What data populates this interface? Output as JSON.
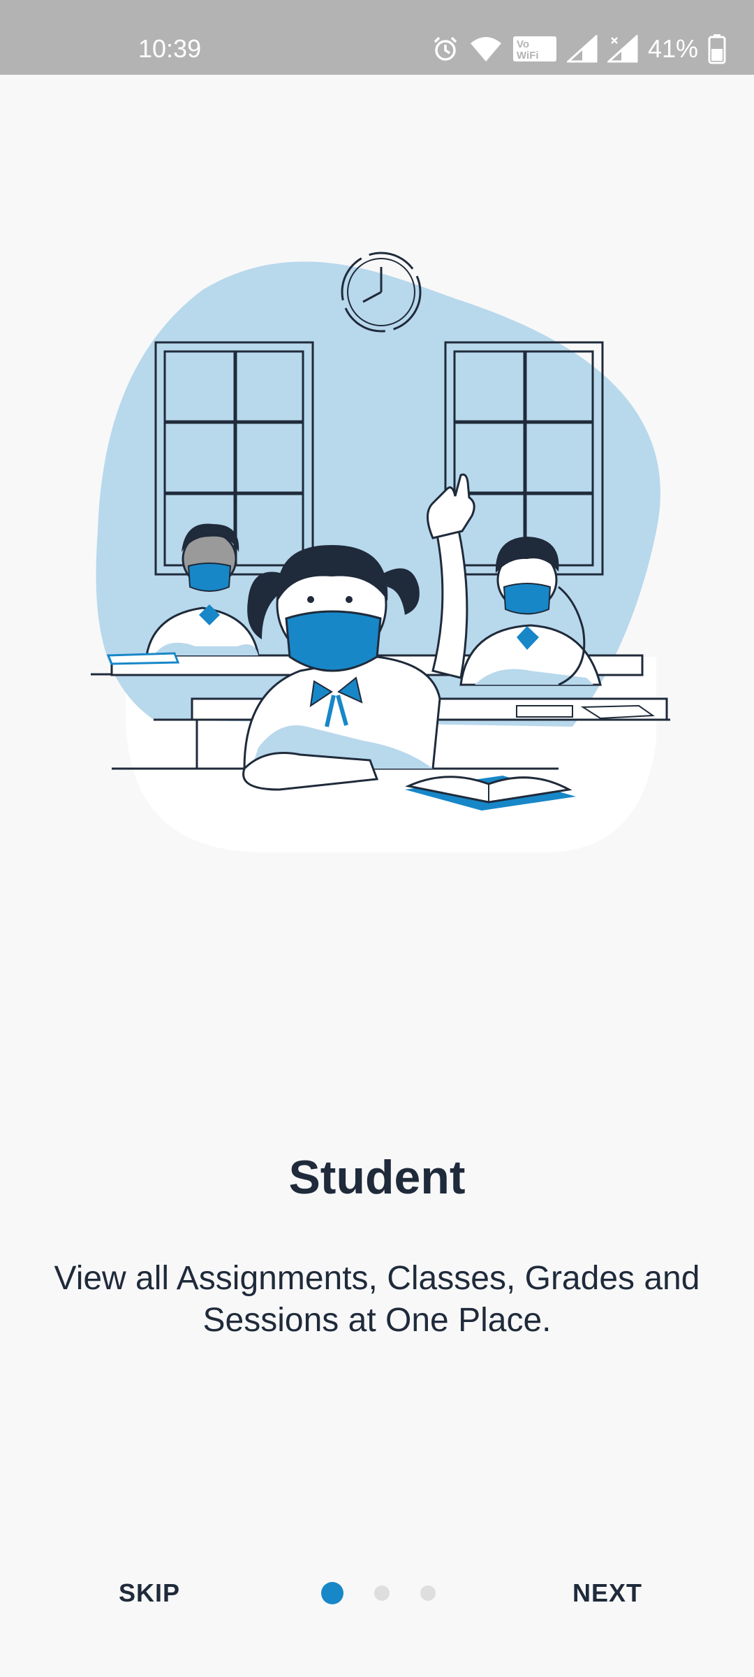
{
  "status_bar": {
    "time": "10:39",
    "battery": "41%",
    "icons": [
      "alarm-icon",
      "wifi-icon",
      "vowifi-icon",
      "signal-icon",
      "signal-x-icon",
      "battery-icon"
    ]
  },
  "onboarding": {
    "title": "Student",
    "subtitle": "View all Assignments, Classes, Grades and Sessions at One Place.",
    "skip_label": "SKIP",
    "next_label": "NEXT",
    "page_count": 3,
    "current_page": 1
  },
  "colors": {
    "accent": "#1787c8",
    "blob": "#b8d8ec",
    "text": "#1f2a3a",
    "background": "#f8f8f9",
    "status_bar": "#b3b3b3"
  }
}
